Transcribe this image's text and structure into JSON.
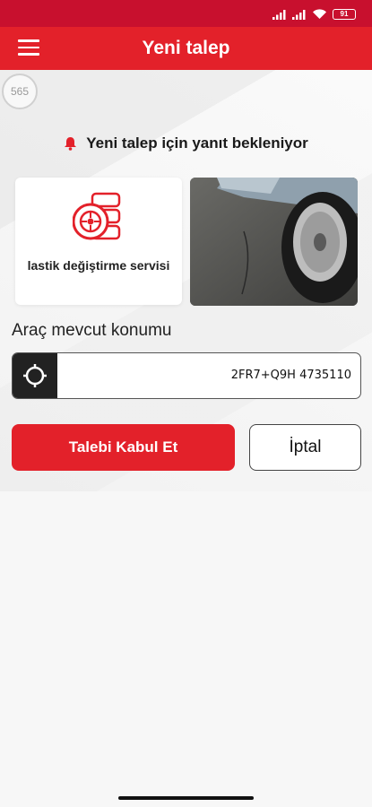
{
  "status_bar": {
    "battery": "91"
  },
  "header": {
    "title": "Yeni talep"
  },
  "badge": {
    "value": "565"
  },
  "status_message": "Yeni talep için yanıt bekleniyor",
  "service": {
    "label": "lastik değiştirme servisi",
    "icon": "tire-stack-icon"
  },
  "location": {
    "label": "Araç mevcut konumu",
    "value": "2FR7+Q9H  4735110"
  },
  "actions": {
    "accept_label": "Talebi Kabul Et",
    "cancel_label": "İptal"
  },
  "colors": {
    "primary": "#e3212a",
    "status_bar": "#c8102e",
    "dark": "#222222"
  }
}
